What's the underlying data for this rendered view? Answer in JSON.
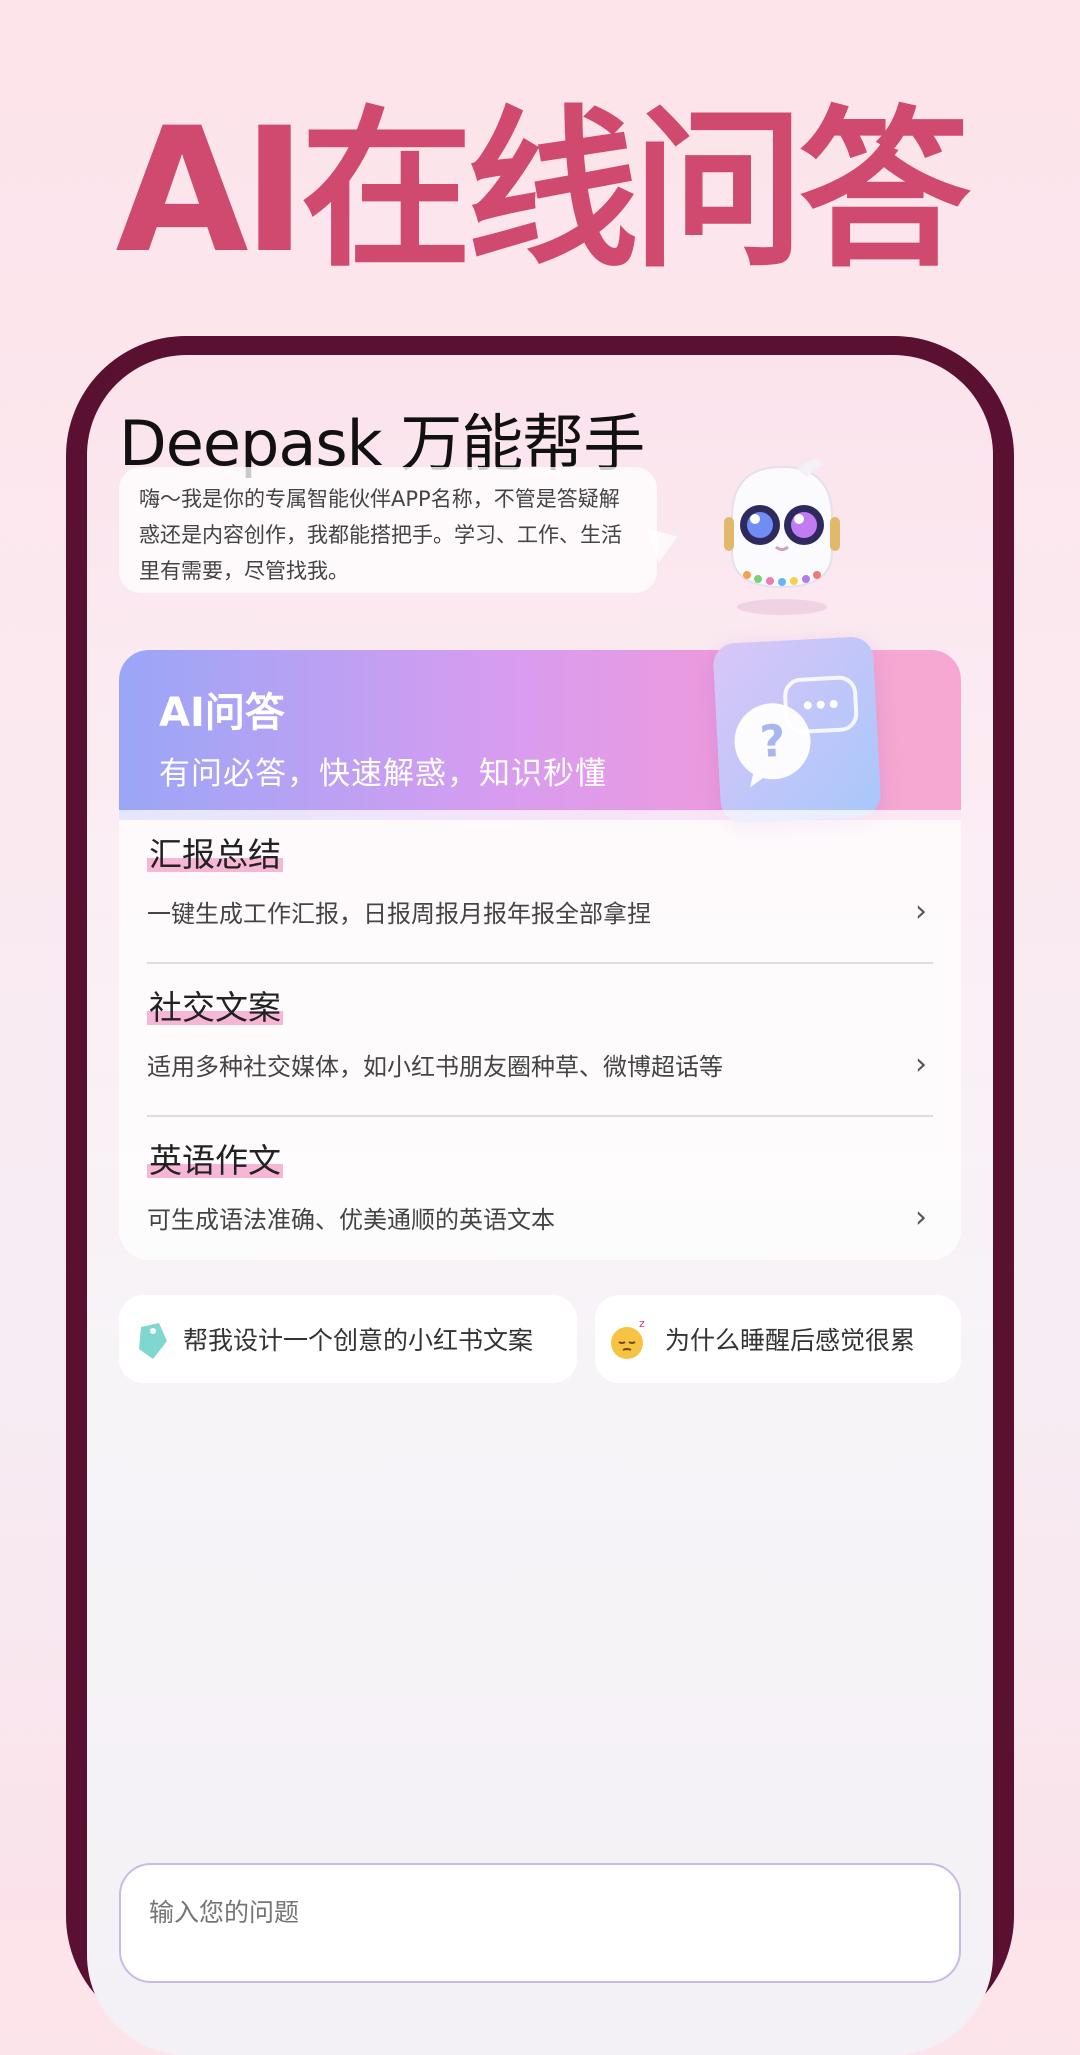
{
  "headline": "AI在线问答",
  "app": {
    "title": "Deepask 万能帮手",
    "intro": "嗨～我是你的专属智能伙伴APP名称，不管是答疑解惑还是内容创作，我都能搭把手。学习、工作、生活里有需要，尽管找我。"
  },
  "qa_banner": {
    "title": "AI问答",
    "subtitle": "有问必答，快速解惑，知识秒懂"
  },
  "features": [
    {
      "title": "汇报总结",
      "desc": "一键生成工作汇报，日报周报月报年报全部拿捏"
    },
    {
      "title": "社交文案",
      "desc": "适用多种社交媒体，如小红书朋友圈种草、微博超话等"
    },
    {
      "title": "英语作文",
      "desc": "可生成语法准确、优美通顺的英语文本"
    }
  ],
  "suggestions": [
    {
      "icon": "tag-icon",
      "text": "帮我设计一个创意的小红书文案"
    },
    {
      "icon": "sleepy-face-icon",
      "text": "为什么睡醒后感觉很累"
    }
  ],
  "chat_input": {
    "placeholder": "输入您的问题"
  },
  "colors": {
    "headline": "#cf4a6e",
    "frame": "#5a1131",
    "highlight": "#f7b6d6"
  }
}
